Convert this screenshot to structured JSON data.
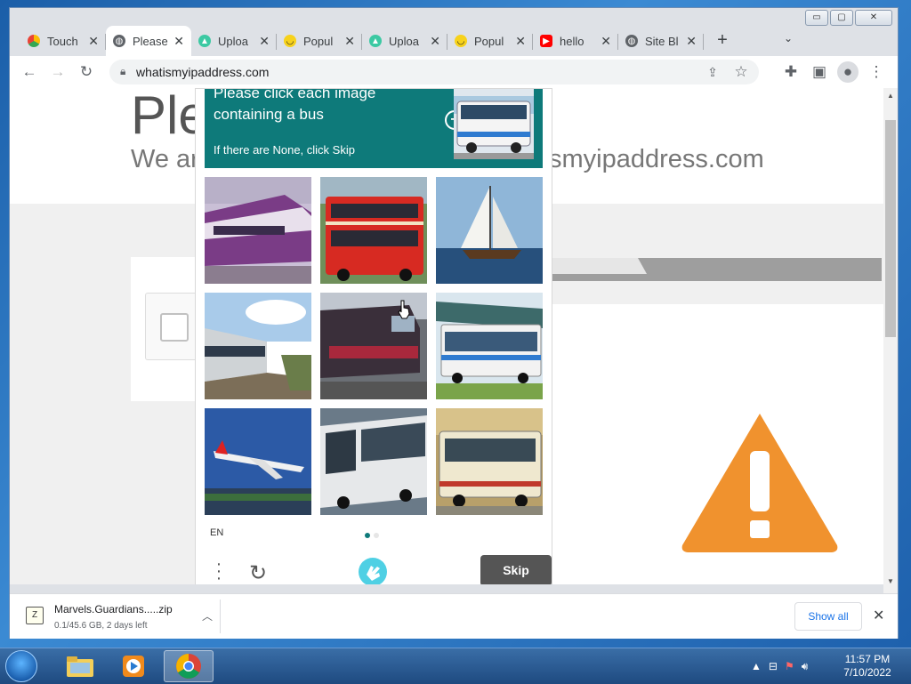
{
  "browser": {
    "tabs": [
      {
        "title": "Touch",
        "favicon": "google-drive-icon",
        "active": false
      },
      {
        "title": "Please",
        "favicon": "globe-icon",
        "active": true
      },
      {
        "title": "Uploa",
        "favicon": "upload-site-icon",
        "active": false
      },
      {
        "title": "Popul",
        "favicon": "smile-icon",
        "active": false
      },
      {
        "title": "Uploa",
        "favicon": "upload-site-icon",
        "active": false
      },
      {
        "title": "Popul",
        "favicon": "smile-icon",
        "active": false
      },
      {
        "title": "hello",
        "favicon": "youtube-icon",
        "active": false
      },
      {
        "title": "Site Bl",
        "favicon": "globe-icon",
        "active": false
      }
    ],
    "new_tab": "+",
    "url": "whatismyipaddress.com",
    "window_controls": {
      "minimize": "▭",
      "maximize": "▢",
      "close": "✕"
    }
  },
  "page": {
    "title": "Ple",
    "subtitle_left": "We ar",
    "subtitle_right": "smyipaddress.com"
  },
  "captcha": {
    "instruction": "Please click each image containing a bus",
    "skip_note": "If there are None, click Skip",
    "plus": "+",
    "images": [
      {
        "label": "purple-train"
      },
      {
        "label": "red-double-decker-bus"
      },
      {
        "label": "sailboat"
      },
      {
        "label": "train-platform"
      },
      {
        "label": "locomotive"
      },
      {
        "label": "city-bus"
      },
      {
        "label": "airplane"
      },
      {
        "label": "coach-bus"
      },
      {
        "label": "cream-bus"
      }
    ],
    "language": "EN",
    "skip_label": "Skip",
    "accent_color": "#0e7a7a"
  },
  "downloads": {
    "file_name": "Marvels.Guardians.....zip",
    "file_meta": "0.1/45.6 GB, 2 days left",
    "show_all": "Show all"
  },
  "taskbar": {
    "time": "11:57 PM",
    "date": "7/10/2022"
  }
}
